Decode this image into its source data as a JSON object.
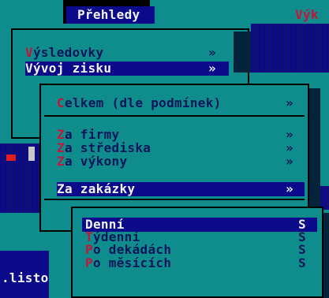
{
  "menubar": {
    "overview": "Přehledy",
    "right_fragment": "Výk"
  },
  "status": {
    "left_fragment": ".listo"
  },
  "menu_level1": {
    "items": [
      {
        "hotkey": "V",
        "rest": "ýsledovky",
        "accel": "»"
      },
      {
        "hotkey": "V",
        "rest": "ývoj zisku",
        "accel": "»",
        "selected": true
      }
    ]
  },
  "menu_level2": {
    "items": [
      {
        "hotkey": "C",
        "rest": "elkem (dle podmínek)",
        "accel": "»"
      },
      {
        "hotkey": "Z",
        "rest": "a firmy",
        "accel": "»"
      },
      {
        "hotkey": "Z",
        "rest": "a střediska",
        "accel": "»"
      },
      {
        "hotkey": "Z",
        "rest": "a výkony",
        "accel": "»"
      },
      {
        "hotkey": "Z",
        "rest": "a zakázky",
        "accel": "»",
        "selected": true
      }
    ]
  },
  "menu_level3": {
    "items": [
      {
        "hotkey": "D",
        "rest": "enní",
        "accel": "S",
        "selected": true
      },
      {
        "hotkey": "T",
        "rest": "ýdenní",
        "accel": "S"
      },
      {
        "hotkey": "P",
        "rest": "o dekádách",
        "accel": "S"
      },
      {
        "hotkey": "P",
        "rest": "o měsících",
        "accel": "S"
      }
    ]
  },
  "colors": {
    "background": "#0f8d8d",
    "selection": "#0a0a8a",
    "text": "#06165a",
    "hotkey": "#c8143a",
    "selected_text": "#f2f2f2"
  }
}
